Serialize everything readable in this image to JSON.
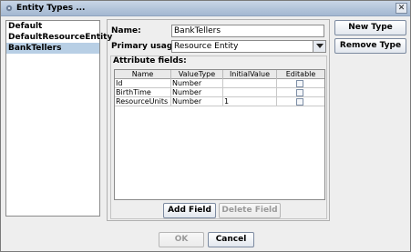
{
  "window": {
    "title": "Entity Types ...",
    "close_label": "✕"
  },
  "entity_list": {
    "items": [
      {
        "label": "Default",
        "selected": false
      },
      {
        "label": "DefaultResourceEntity",
        "selected": false
      },
      {
        "label": "BankTellers",
        "selected": true
      }
    ]
  },
  "form": {
    "name_label": "Name:",
    "name_value": "BankTellers",
    "usage_label": "Primary usage:",
    "usage_value": "Resource Entity",
    "attributes_label": "Attribute fields:"
  },
  "table": {
    "columns": [
      "Name",
      "ValueType",
      "InitialValue",
      "Editable"
    ],
    "rows": [
      {
        "name": "Id",
        "type": "Number",
        "initial": "",
        "editable": false
      },
      {
        "name": "BirthTime",
        "type": "Number",
        "initial": "",
        "editable": false
      },
      {
        "name": "ResourceUnits",
        "type": "Number",
        "initial": "1",
        "editable": false
      }
    ]
  },
  "buttons": {
    "new_type": "New Type",
    "remove_type": "Remove Type",
    "add_field": "Add Field",
    "delete_field": "Delete Field",
    "ok": "OK",
    "cancel": "Cancel"
  },
  "colors": {
    "selection": "#b8cfe5",
    "titlebar": "#b2c4da"
  },
  "icons": {
    "app": "gear-icon",
    "close": "close-icon",
    "dropdown": "chevron-down-icon"
  }
}
